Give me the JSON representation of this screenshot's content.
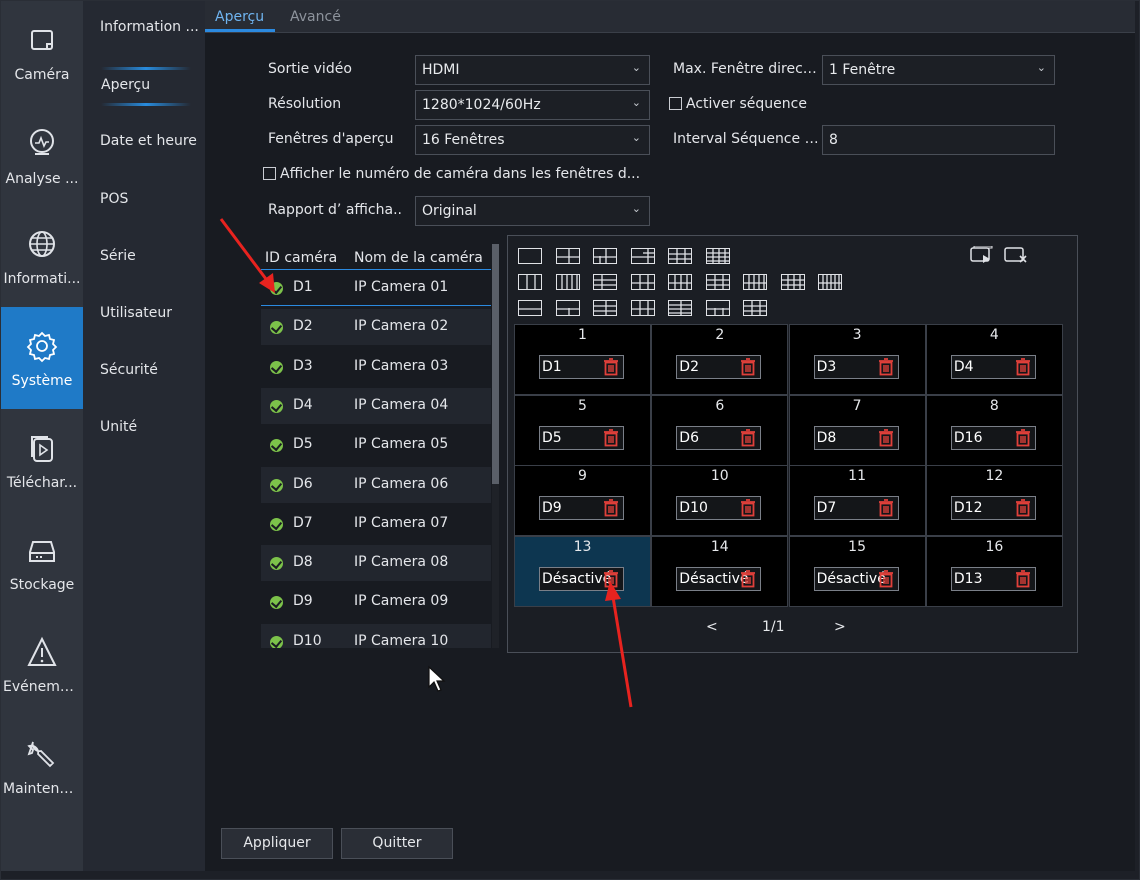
{
  "rail": [
    {
      "label": "Caméra",
      "icon": "camera-icon"
    },
    {
      "label": "Analyse ...",
      "icon": "analysis-icon"
    },
    {
      "label": "Informati...",
      "icon": "globe-icon"
    },
    {
      "label": "Système",
      "icon": "gear-icon"
    },
    {
      "label": "Téléchar...",
      "icon": "download-icon"
    },
    {
      "label": "Stockage",
      "icon": "storage-icon"
    },
    {
      "label": "Evéneme...",
      "icon": "warning-icon"
    },
    {
      "label": "Maintena...",
      "icon": "wrench-icon"
    }
  ],
  "subnav": [
    "Information ...",
    "Aperçu",
    "Date et heure",
    "POS",
    "Série",
    "Utilisateur",
    "Sécurité",
    "Unité"
  ],
  "tabs": {
    "active": "Aperçu",
    "inactive": "Avancé"
  },
  "form": {
    "sortie_label": "Sortie vidéo",
    "sortie_value": "HDMI",
    "resolution_label": "Résolution",
    "resolution_value": "1280*1024/60Hz",
    "fenetres_label": "Fenêtres d'aperçu",
    "fenetres_value": "16 Fenêtres",
    "afficher_label": "Afficher le numéro de caméra dans les fenêtres d...",
    "rapport_label": "Rapport d’ afficha..",
    "rapport_value": "Original",
    "max_label": "Max. Fenêtre direct...",
    "max_value": "1 Fenêtre",
    "sequence_label": "Activer séquence",
    "interval_label": "Interval Séquence (...",
    "interval_value": "8"
  },
  "camera_list": {
    "header_id": "ID caméra",
    "header_name": "Nom de la caméra",
    "rows": [
      {
        "id": "D1",
        "name": "IP Camera 01"
      },
      {
        "id": "D2",
        "name": "IP Camera 02"
      },
      {
        "id": "D3",
        "name": "IP Camera 03"
      },
      {
        "id": "D4",
        "name": "IP Camera 04"
      },
      {
        "id": "D5",
        "name": "IP Camera 05"
      },
      {
        "id": "D6",
        "name": "IP Camera 06"
      },
      {
        "id": "D7",
        "name": "IP Camera 07"
      },
      {
        "id": "D8",
        "name": "IP Camera 08"
      },
      {
        "id": "D9",
        "name": "IP Camera 09"
      },
      {
        "id": "D10",
        "name": "IP Camera 10"
      }
    ]
  },
  "windows": [
    {
      "num": "1",
      "cam": "D1"
    },
    {
      "num": "2",
      "cam": "D2"
    },
    {
      "num": "3",
      "cam": "D3"
    },
    {
      "num": "4",
      "cam": "D4"
    },
    {
      "num": "5",
      "cam": "D5"
    },
    {
      "num": "6",
      "cam": "D6"
    },
    {
      "num": "7",
      "cam": "D8"
    },
    {
      "num": "8",
      "cam": "D16"
    },
    {
      "num": "9",
      "cam": "D9"
    },
    {
      "num": "10",
      "cam": "D10"
    },
    {
      "num": "11",
      "cam": "D7"
    },
    {
      "num": "12",
      "cam": "D12"
    },
    {
      "num": "13",
      "cam": "Désactivé"
    },
    {
      "num": "14",
      "cam": "Désactivé"
    },
    {
      "num": "15",
      "cam": "Désactivé"
    },
    {
      "num": "16",
      "cam": "D13"
    }
  ],
  "pager": {
    "prev": "<",
    "page": "1/1",
    "next": ">"
  },
  "buttons": {
    "apply": "Appliquer",
    "quit": "Quitter"
  },
  "colors": {
    "accent": "#2b8ae0",
    "active_rail": "#1f7ac7",
    "ok": "#7cc24a",
    "delete": "#e0403a",
    "annotation": "#e8231f"
  }
}
